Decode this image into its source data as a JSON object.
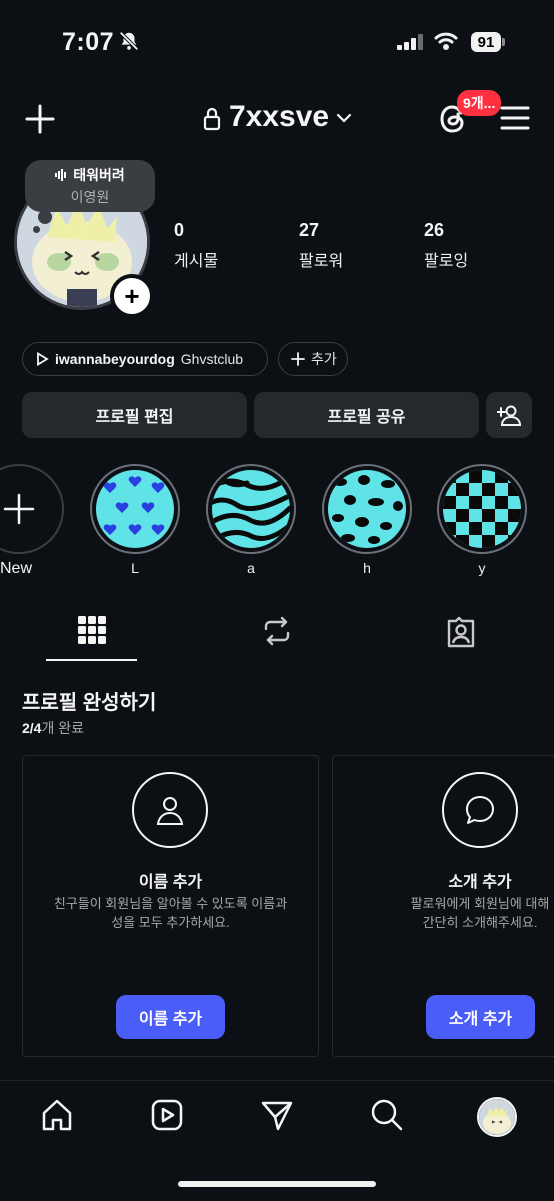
{
  "status_bar": {
    "time": "7:07",
    "battery": "91"
  },
  "header": {
    "username": "7xxsve",
    "threads_badge": "9개..."
  },
  "note": {
    "title": "태워버려",
    "artist": "이영원"
  },
  "stats": [
    {
      "value": "0",
      "label": "게시물"
    },
    {
      "value": "27",
      "label": "팔로워"
    },
    {
      "value": "26",
      "label": "팔로잉"
    }
  ],
  "music": {
    "song": "iwannabeyourdog",
    "artist": "Ghvstclub",
    "add_label": "추가"
  },
  "buttons": {
    "edit_profile": "프로필 편집",
    "share_profile": "프로필 공유"
  },
  "highlights": {
    "new_label": "New",
    "items": [
      {
        "label": "L",
        "pattern": "hearts"
      },
      {
        "label": "a",
        "pattern": "zebra"
      },
      {
        "label": "h",
        "pattern": "leopard"
      },
      {
        "label": "y",
        "pattern": "checker"
      }
    ]
  },
  "complete_profile": {
    "title": "프로필 완성하기",
    "progress_strong": "2/4",
    "progress_rest": "개 완료",
    "cards": [
      {
        "title": "이름 추가",
        "desc_line1": "친구들이 회원님을 알아볼 수 있도록 이름과",
        "desc_line2": "성을 모두 추가하세요.",
        "button": "이름 추가",
        "icon": "person-icon"
      },
      {
        "title": "소개 추가",
        "desc_line1": "팔로워에게 회원님에 대해",
        "desc_line2": "간단히 소개해주세요.",
        "button": "소개 추가",
        "icon": "speech-bubble-icon"
      }
    ]
  },
  "colors": {
    "background": "#0c1014",
    "accent_blue": "#4a5df9",
    "badge_red": "#ff3040",
    "highlight_teal": "#5fe3e6"
  }
}
